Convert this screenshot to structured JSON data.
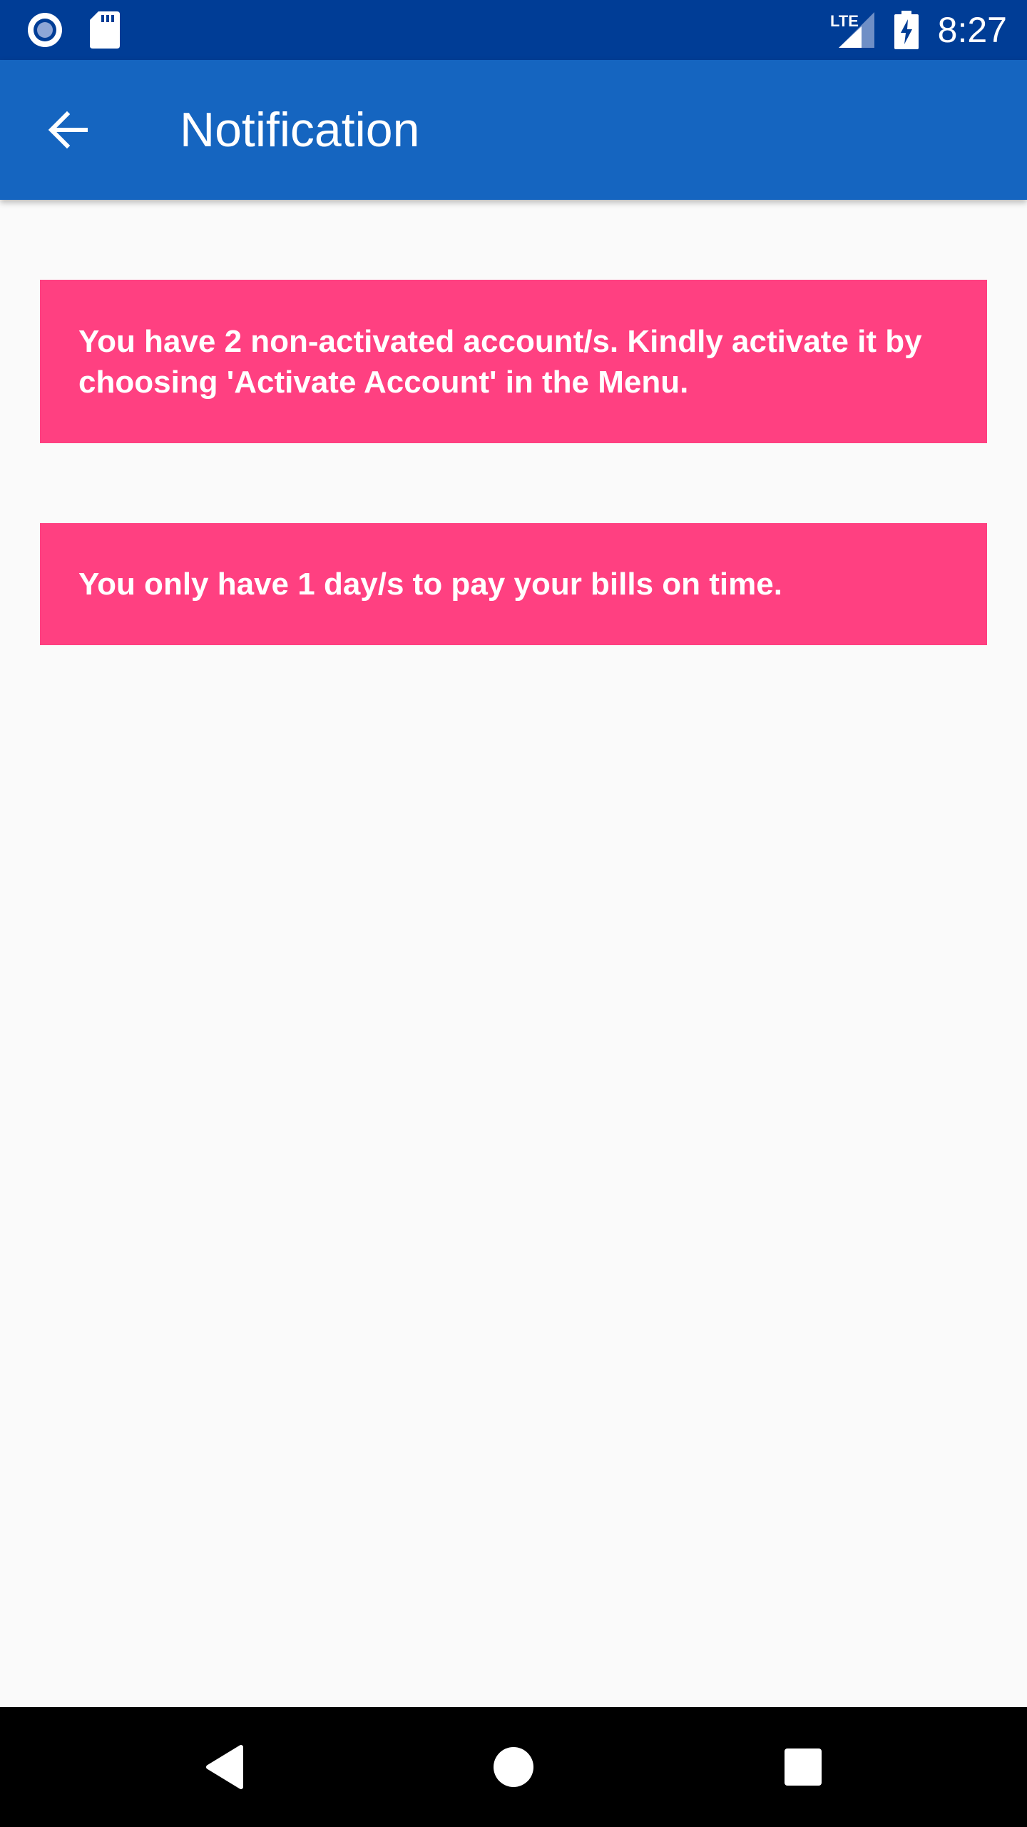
{
  "status_bar": {
    "time": "8:27",
    "network_label": "LTE",
    "icons": [
      "record-icon",
      "sd-card-icon",
      "lte-signal-icon",
      "battery-charging-icon"
    ]
  },
  "app_bar": {
    "title": "Notification",
    "back_icon": "arrow-back-icon"
  },
  "notifications": [
    {
      "message": "You have 2 non-activated account/s. Kindly activate it by choosing 'Activate Account' in the Menu."
    },
    {
      "message": "You only have 1 day/s to pay your bills on time."
    }
  ],
  "nav_bar": {
    "icons": [
      "back-triangle-icon",
      "home-circle-icon",
      "recents-square-icon"
    ]
  },
  "colors": {
    "status_bar": "#003d96",
    "app_bar": "#1565c0",
    "notice": "#ff4081",
    "background": "#fafafa"
  }
}
